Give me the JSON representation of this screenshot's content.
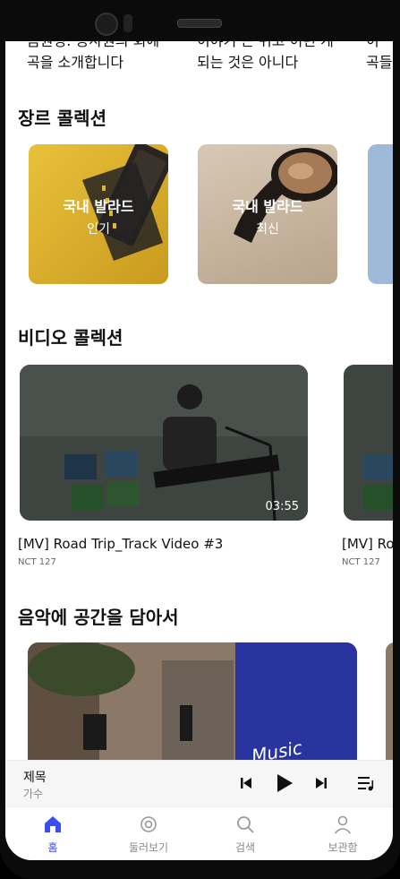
{
  "top_captions": [
    {
      "line1": "음원정: 공사원의 회에",
      "line2": "곡을 소개합니다"
    },
    {
      "line1": "이야기 든 쉬고 이런 게",
      "line2": "되는 것은 아니다"
    },
    {
      "line1": "이",
      "line2": "곡들"
    }
  ],
  "genre_section": {
    "title": "장르 콜렉션",
    "cards": [
      {
        "title": "국내 발라드",
        "subtitle": "인기"
      },
      {
        "title": "국내 발라드",
        "subtitle": "최신"
      }
    ]
  },
  "video_section": {
    "title": "비디오 콜렉션",
    "videos": [
      {
        "title": "[MV] Road Trip_Track Video #3",
        "artist": "NCT 127",
        "duration": "03:55"
      },
      {
        "title": "[MV] Ro",
        "artist": "NCT 127"
      }
    ]
  },
  "space_section": {
    "title": "음악에 공간을 담아서",
    "card_text": "Music"
  },
  "mini_player": {
    "title": "제목",
    "artist": "가수",
    "icons": [
      "skip-previous-icon",
      "play-icon",
      "skip-next-icon",
      "queue-icon"
    ]
  },
  "tabs": [
    {
      "label": "홈",
      "icon": "home-icon",
      "active": true
    },
    {
      "label": "둘러보기",
      "icon": "explore-icon",
      "active": false
    },
    {
      "label": "검색",
      "icon": "search-icon",
      "active": false
    },
    {
      "label": "보관함",
      "icon": "person-icon",
      "active": false
    }
  ],
  "colors": {
    "accent": "#3b4cf5",
    "genre_yellow": "#e0b632",
    "genre_beige": "#c9b8a6",
    "genre_blue": "#9fbad9",
    "space_blue": "#2a34a0"
  }
}
